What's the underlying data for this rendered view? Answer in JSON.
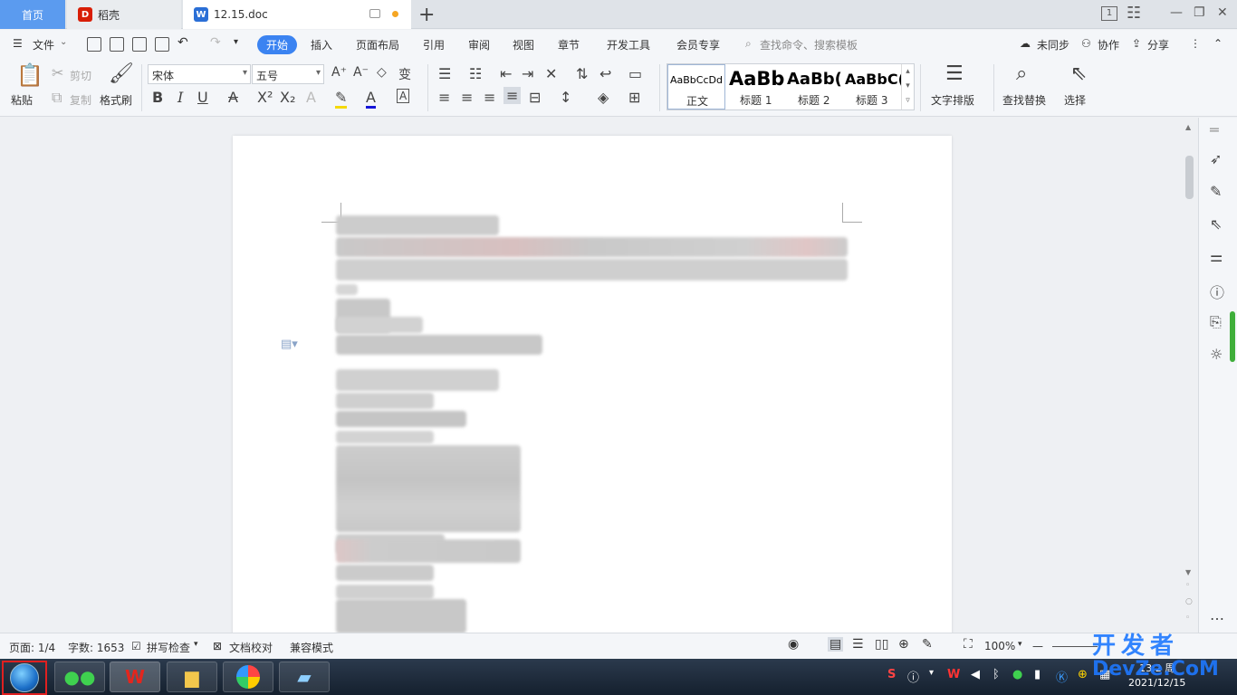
{
  "tabs": {
    "home": "首页",
    "docer": "稻壳",
    "doc": "12.15.doc"
  },
  "window": {
    "account_badge": "1"
  },
  "menu": {
    "file": "文件",
    "items": [
      "开始",
      "插入",
      "页面布局",
      "引用",
      "审阅",
      "视图",
      "章节",
      "开发工具",
      "会员专享"
    ],
    "search_placeholder": "查找命令、搜索模板",
    "sync": "未同步",
    "collab": "协作",
    "share": "分享"
  },
  "ribbon": {
    "paste": "粘贴",
    "cut": "剪切",
    "copy": "复制",
    "format_painter": "格式刷",
    "font_name": "宋体",
    "font_size": "五号",
    "styles": [
      {
        "sample": "AaBbCcDd",
        "name": "正文"
      },
      {
        "sample": "AaBb",
        "name": "标题 1"
      },
      {
        "sample": "AaBb(",
        "name": "标题 2"
      },
      {
        "sample": "AaBbC(",
        "name": "标题 3"
      }
    ],
    "text_layout": "文字排版",
    "find_replace": "查找替换",
    "select": "选择"
  },
  "status": {
    "page": "页面: 1/4",
    "words": "字数: 1653",
    "spellcheck": "拼写检查",
    "doc_proof": "文档校对",
    "compat": "兼容模式",
    "zoom": "100%"
  },
  "taskbar": {
    "clock_time": "13:2",
    "clock_date": "2021/12/15",
    "weekday": "周"
  },
  "watermark": {
    "line1": "开发者",
    "line2": "DevZe.CoM"
  },
  "colors": {
    "accent": "#3b83f1",
    "home_tab": "#5b9bef",
    "wps_red": "#d81e06",
    "word_blue": "#2b6fd6"
  }
}
